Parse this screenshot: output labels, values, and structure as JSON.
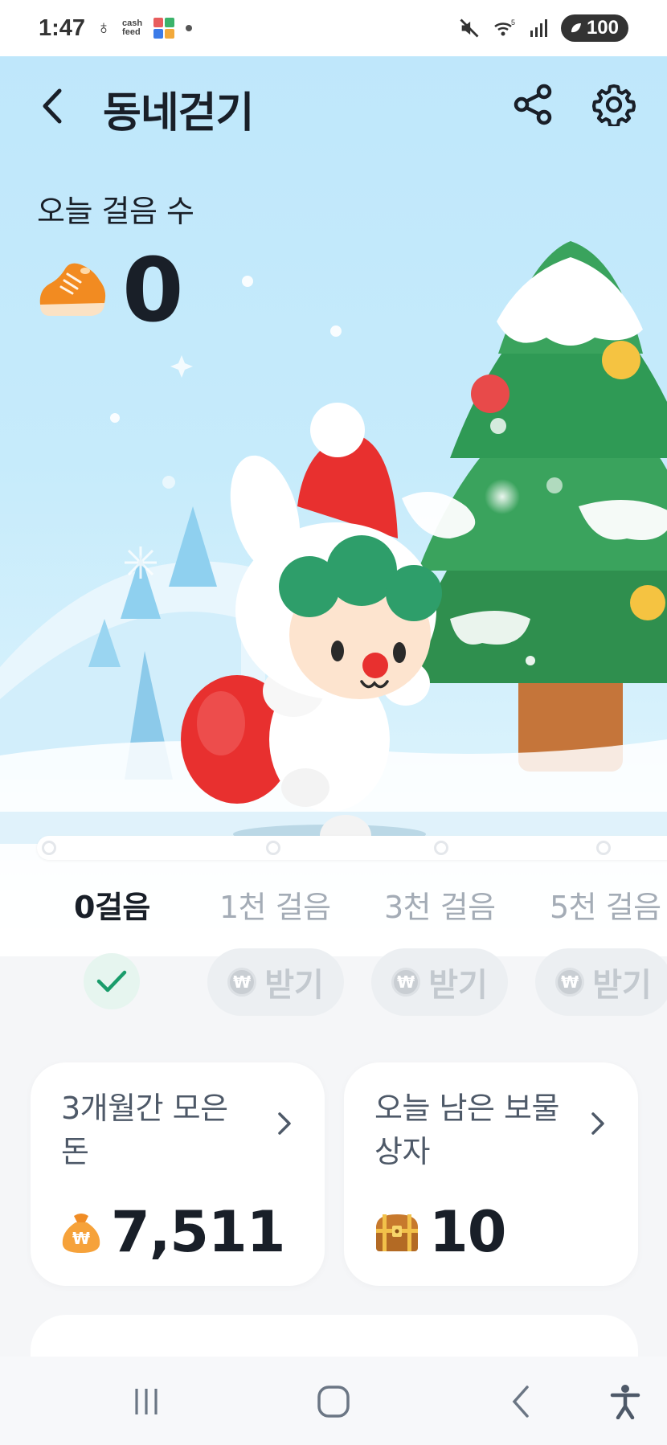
{
  "status_bar": {
    "time": "1:47",
    "notification_app": "cash feed",
    "battery": "100"
  },
  "header": {
    "title": "동네걷기"
  },
  "steps": {
    "label": "오늘 걸음 수",
    "count": "0"
  },
  "milestones": [
    {
      "label": "0걸음",
      "state": "done"
    },
    {
      "label": "1천 걸음",
      "claim_label": "받기",
      "state": "locked"
    },
    {
      "label": "3천 걸음",
      "claim_label": "받기",
      "state": "locked"
    },
    {
      "label": "5천 걸음",
      "claim_label": "받기",
      "state": "locked"
    }
  ],
  "cards": {
    "money": {
      "title": "3개월간 모은 돈",
      "value": "7,511",
      "icon": "money-bag-icon"
    },
    "treasure": {
      "title": "오늘 남은 보물 상자",
      "value": "10",
      "icon": "treasure-chest-icon"
    }
  },
  "nav": {
    "items": [
      "recents-icon",
      "home-icon",
      "back-icon",
      "accessibility-icon"
    ]
  },
  "colors": {
    "accent_green": "#1a9c6b",
    "sky": "#bfe7fb",
    "text_primary": "#191f28",
    "text_secondary": "#4e5968",
    "disabled": "#c3c9cf"
  }
}
